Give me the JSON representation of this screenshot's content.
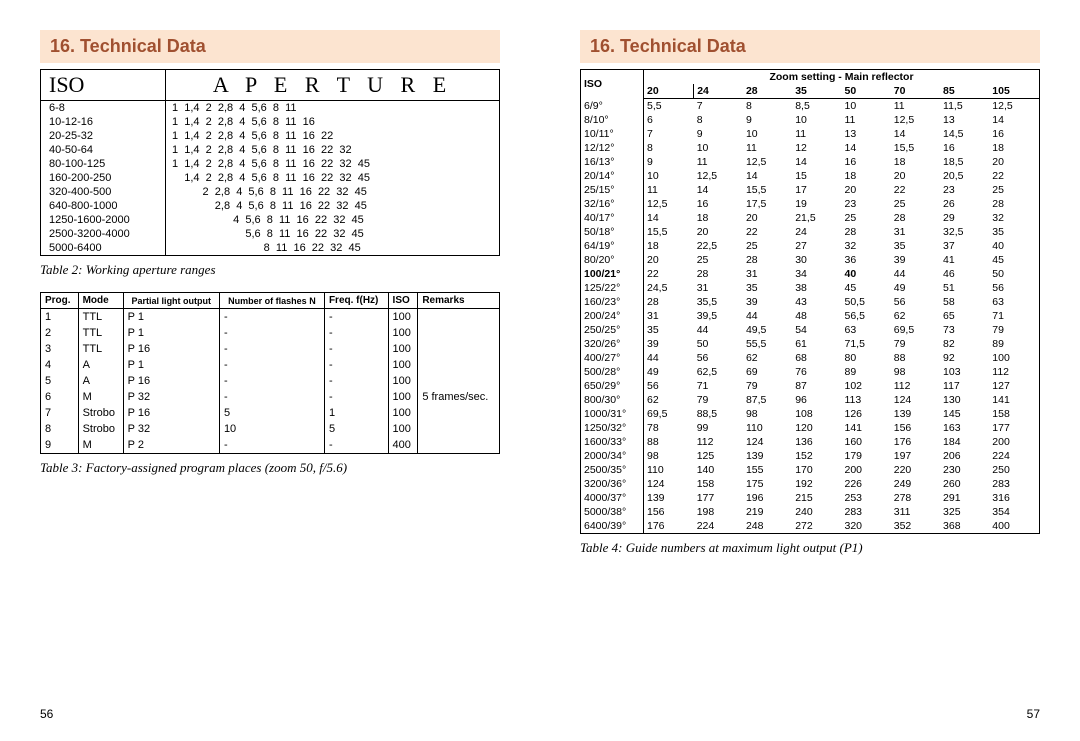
{
  "heading": "16. Technical Data",
  "page_left": "56",
  "page_right": "57",
  "table2": {
    "hdr_iso": "ISO",
    "hdr_ap": "A P E R T U R E",
    "caption": "Table 2: Working aperture ranges",
    "rows": [
      {
        "iso": "6-8",
        "ap": "1  1,4  2  2,8  4  5,6  8  11"
      },
      {
        "iso": "10-12-16",
        "ap": "1  1,4  2  2,8  4  5,6  8  11  16"
      },
      {
        "iso": "20-25-32",
        "ap": "1  1,4  2  2,8  4  5,6  8  11  16  22"
      },
      {
        "iso": "40-50-64",
        "ap": "1  1,4  2  2,8  4  5,6  8  11  16  22  32"
      },
      {
        "iso": "80-100-125",
        "ap": "1  1,4  2  2,8  4  5,6  8  11  16  22  32  45"
      },
      {
        "iso": "160-200-250",
        "ap": "    1,4  2  2,8  4  5,6  8  11  16  22  32  45"
      },
      {
        "iso": "320-400-500",
        "ap": "          2  2,8  4  5,6  8  11  16  22  32  45"
      },
      {
        "iso": "640-800-1000",
        "ap": "              2,8  4  5,6  8  11  16  22  32  45"
      },
      {
        "iso": "1250-1600-2000",
        "ap": "                    4  5,6  8  11  16  22  32  45"
      },
      {
        "iso": "2500-3200-4000",
        "ap": "                        5,6  8  11  16  22  32  45"
      },
      {
        "iso": "5000-6400",
        "ap": "                              8  11  16  22  32  45"
      }
    ]
  },
  "table3": {
    "caption": "Table 3: Factory-assigned program places (zoom 50, f/5.6)",
    "headers": [
      "Prog.",
      "Mode",
      "Partial light output",
      "Number of flashes N",
      "Freq. f(Hz)",
      "ISO",
      "Remarks"
    ],
    "rows": [
      [
        "1",
        "TTL",
        "P 1",
        "-",
        "-",
        "100",
        ""
      ],
      [
        "2",
        "TTL",
        "P 1",
        "-",
        "-",
        "100",
        ""
      ],
      [
        "3",
        "TTL",
        "P 16",
        "-",
        "-",
        "100",
        ""
      ],
      [
        "4",
        "A",
        "P 1",
        "-",
        "-",
        "100",
        ""
      ],
      [
        "5",
        "A",
        "P 16",
        "-",
        "-",
        "100",
        ""
      ],
      [
        "6",
        "M",
        "P 32",
        "-",
        "-",
        "100",
        "5 frames/sec."
      ],
      [
        "7",
        "Strobo",
        "P 16",
        "5",
        "1",
        "100",
        ""
      ],
      [
        "8",
        "Strobo",
        "P 32",
        "10",
        "5",
        "100",
        ""
      ],
      [
        "9",
        "M",
        "P 2",
        "-",
        "-",
        "400",
        ""
      ]
    ]
  },
  "table4": {
    "caption": "Table 4: Guide numbers at maximum light output (P1)",
    "hdr_iso": "ISO",
    "hdr_zoom": "Zoom setting - Main reflector",
    "zoom_cols": [
      "20",
      "24",
      "28",
      "35",
      "50",
      "70",
      "85",
      "105"
    ],
    "bold_row_iso": "100/21°",
    "rows": [
      {
        "iso": "6/9°",
        "v": [
          "5,5",
          "7",
          "8",
          "8,5",
          "10",
          "11",
          "11,5",
          "12,5"
        ]
      },
      {
        "iso": "8/10°",
        "v": [
          "6",
          "8",
          "9",
          "10",
          "11",
          "12,5",
          "13",
          "14"
        ]
      },
      {
        "iso": "10/11°",
        "v": [
          "7",
          "9",
          "10",
          "11",
          "13",
          "14",
          "14,5",
          "16"
        ]
      },
      {
        "iso": "12/12°",
        "v": [
          "8",
          "10",
          "11",
          "12",
          "14",
          "15,5",
          "16",
          "18"
        ]
      },
      {
        "iso": "16/13°",
        "v": [
          "9",
          "11",
          "12,5",
          "14",
          "16",
          "18",
          "18,5",
          "20"
        ]
      },
      {
        "iso": "20/14°",
        "v": [
          "10",
          "12,5",
          "14",
          "15",
          "18",
          "20",
          "20,5",
          "22"
        ]
      },
      {
        "iso": "25/15°",
        "v": [
          "11",
          "14",
          "15,5",
          "17",
          "20",
          "22",
          "23",
          "25"
        ]
      },
      {
        "iso": "32/16°",
        "v": [
          "12,5",
          "16",
          "17,5",
          "19",
          "23",
          "25",
          "26",
          "28"
        ]
      },
      {
        "iso": "40/17°",
        "v": [
          "14",
          "18",
          "20",
          "21,5",
          "25",
          "28",
          "29",
          "32"
        ]
      },
      {
        "iso": "50/18°",
        "v": [
          "15,5",
          "20",
          "22",
          "24",
          "28",
          "31",
          "32,5",
          "35"
        ]
      },
      {
        "iso": "64/19°",
        "v": [
          "18",
          "22,5",
          "25",
          "27",
          "32",
          "35",
          "37",
          "40"
        ]
      },
      {
        "iso": "80/20°",
        "v": [
          "20",
          "25",
          "28",
          "30",
          "36",
          "39",
          "41",
          "45"
        ]
      },
      {
        "iso": "100/21°",
        "v": [
          "22",
          "28",
          "31",
          "34",
          "40",
          "44",
          "46",
          "50"
        ]
      },
      {
        "iso": "125/22°",
        "v": [
          "24,5",
          "31",
          "35",
          "38",
          "45",
          "49",
          "51",
          "56"
        ]
      },
      {
        "iso": "160/23°",
        "v": [
          "28",
          "35,5",
          "39",
          "43",
          "50,5",
          "56",
          "58",
          "63"
        ]
      },
      {
        "iso": "200/24°",
        "v": [
          "31",
          "39,5",
          "44",
          "48",
          "56,5",
          "62",
          "65",
          "71"
        ]
      },
      {
        "iso": "250/25°",
        "v": [
          "35",
          "44",
          "49,5",
          "54",
          "63",
          "69,5",
          "73",
          "79"
        ]
      },
      {
        "iso": "320/26°",
        "v": [
          "39",
          "50",
          "55,5",
          "61",
          "71,5",
          "79",
          "82",
          "89"
        ]
      },
      {
        "iso": "400/27°",
        "v": [
          "44",
          "56",
          "62",
          "68",
          "80",
          "88",
          "92",
          "100"
        ]
      },
      {
        "iso": "500/28°",
        "v": [
          "49",
          "62,5",
          "69",
          "76",
          "89",
          "98",
          "103",
          "112"
        ]
      },
      {
        "iso": "650/29°",
        "v": [
          "56",
          "71",
          "79",
          "87",
          "102",
          "112",
          "117",
          "127"
        ]
      },
      {
        "iso": "800/30°",
        "v": [
          "62",
          "79",
          "87,5",
          "96",
          "113",
          "124",
          "130",
          "141"
        ]
      },
      {
        "iso": "1000/31°",
        "v": [
          "69,5",
          "88,5",
          "98",
          "108",
          "126",
          "139",
          "145",
          "158"
        ]
      },
      {
        "iso": "1250/32°",
        "v": [
          "78",
          "99",
          "110",
          "120",
          "141",
          "156",
          "163",
          "177"
        ]
      },
      {
        "iso": "1600/33°",
        "v": [
          "88",
          "112",
          "124",
          "136",
          "160",
          "176",
          "184",
          "200"
        ]
      },
      {
        "iso": "2000/34°",
        "v": [
          "98",
          "125",
          "139",
          "152",
          "179",
          "197",
          "206",
          "224"
        ]
      },
      {
        "iso": "2500/35°",
        "v": [
          "110",
          "140",
          "155",
          "170",
          "200",
          "220",
          "230",
          "250"
        ]
      },
      {
        "iso": "3200/36°",
        "v": [
          "124",
          "158",
          "175",
          "192",
          "226",
          "249",
          "260",
          "283"
        ]
      },
      {
        "iso": "4000/37°",
        "v": [
          "139",
          "177",
          "196",
          "215",
          "253",
          "278",
          "291",
          "316"
        ]
      },
      {
        "iso": "5000/38°",
        "v": [
          "156",
          "198",
          "219",
          "240",
          "283",
          "311",
          "325",
          "354"
        ]
      },
      {
        "iso": "6400/39°",
        "v": [
          "176",
          "224",
          "248",
          "272",
          "320",
          "352",
          "368",
          "400"
        ]
      }
    ]
  }
}
